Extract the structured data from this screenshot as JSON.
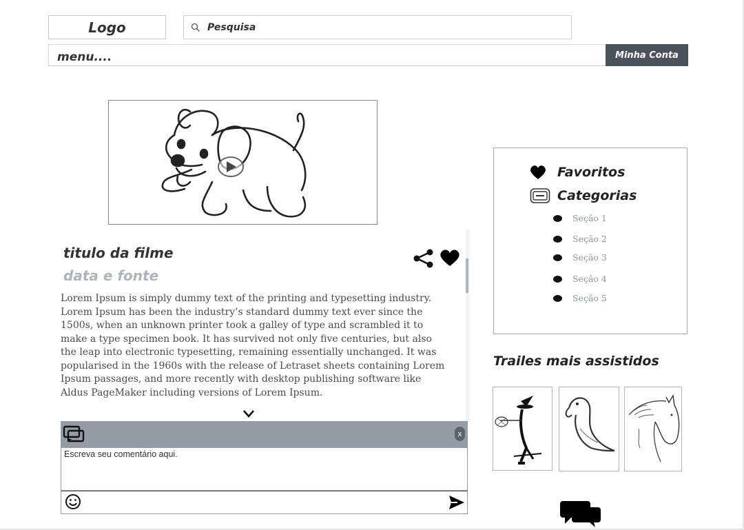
{
  "header": {
    "logo": "Logo",
    "search_placeholder": "Pesquisa",
    "menu_label": "menu....",
    "account_button": "Minha Conta"
  },
  "video": {
    "thumbnail_icon": "puppy-illustration",
    "play_icon": "play-icon"
  },
  "article": {
    "title": "titulo da filme",
    "subtitle": "data e fonte",
    "body": "Lorem Ipsum is simply dummy text of the printing and typesetting industry. Lorem Ipsum has been the industry’s standard dummy text ever since the 1500s, when an unknown printer took a galley of type and scrambled it to make a type specimen book. It has survived not only five centuries, but also the leap into electronic typesetting, remaining essentially unchanged. It was popularised in the 1960s with the release of Letraset sheets containing Lorem Ipsum passages, and more recently with desktop publishing software like Aldus PageMaker including versions of Lorem Ipsum."
  },
  "comments": {
    "close_label": "x",
    "placeholder": "Escreva seu comentário aqui."
  },
  "sidebar": {
    "favorites": "Favoritos",
    "categories": "Categorias",
    "sections": [
      "Seção 1",
      "Seção 2",
      "Seção 3",
      "Seção 4",
      "Seção 5"
    ]
  },
  "trailers": {
    "title": "Trailes mais assistidos",
    "items": [
      "witch-drawing",
      "bird-drawing",
      "horse-drawing"
    ]
  },
  "colors": {
    "account_button_bg": "#4a535c",
    "comment_header_bg": "#959ca6",
    "section_text": "#8d96a0"
  }
}
